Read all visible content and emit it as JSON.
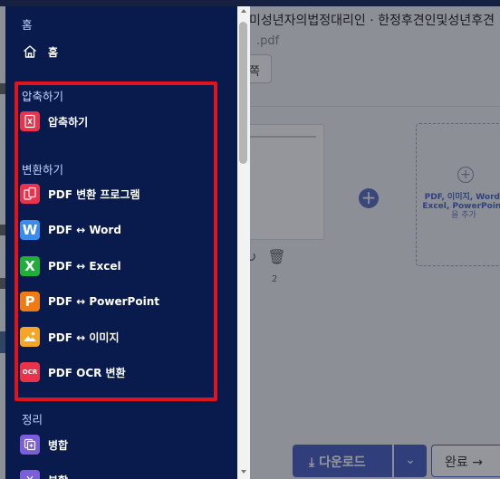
{
  "background": {
    "doc_title": "미성년자의법정대리인 · 한정후견인및성년후견",
    "doc_ext": ".pdf",
    "page_button": "쪽",
    "thumb_number": "2",
    "drop_zone": {
      "title": "PDF, 이미지, Word, Excel, PowerPoint",
      "subtitle": "을 추가"
    },
    "download_button": "다운로드",
    "done_button": "완료 →"
  },
  "menu": {
    "home_section": "홈",
    "home_item": "홈",
    "compress_section": "압축하기",
    "compress_item": "압축하기",
    "convert_section": "변환하기",
    "convert_items": [
      {
        "label": "PDF 변환 프로그램",
        "icon": "pdf-converter-icon",
        "color": "#e8334a"
      },
      {
        "label": "PDF ↔ Word",
        "icon": "word-icon",
        "letter": "W",
        "color": "#3a8bf0"
      },
      {
        "label": "PDF ↔ Excel",
        "icon": "excel-icon",
        "letter": "X",
        "color": "#1fae3a"
      },
      {
        "label": "PDF ↔ PowerPoint",
        "icon": "powerpoint-icon",
        "letter": "P",
        "color": "#f07b12"
      },
      {
        "label": "PDF ↔ 이미지",
        "icon": "image-icon",
        "color": "#f5a623"
      },
      {
        "label": "PDF OCR 변환",
        "icon": "ocr-icon",
        "letter": "OCR",
        "color": "#e8334a"
      }
    ],
    "organize_section": "정리",
    "organize_items": [
      {
        "label": "병합",
        "icon": "merge-icon",
        "color": "#7a5fd8"
      },
      {
        "label": "분할",
        "icon": "split-icon",
        "color": "#7a5fd8"
      }
    ]
  },
  "highlight_color": "#e2141b"
}
